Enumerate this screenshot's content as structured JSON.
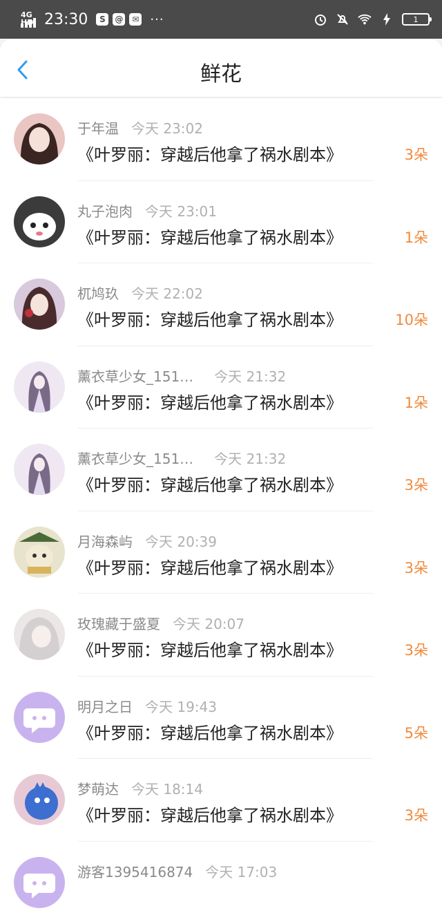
{
  "status_bar": {
    "network": "4G HD",
    "time": "23:30",
    "app_icons": [
      "S",
      "@",
      "✉"
    ],
    "more": "···",
    "battery": "1"
  },
  "header": {
    "title": "鲜花"
  },
  "rows": [
    {
      "name": "于年温",
      "time": "今天 23:02",
      "book": "《叶罗丽：穿越后他拿了祸水剧本》",
      "count": "3朵",
      "avatar_color": "#e9c6c2"
    },
    {
      "name": "丸子泡肉",
      "time": "今天 23:01",
      "book": "《叶罗丽：穿越后他拿了祸水剧本》",
      "count": "1朵",
      "avatar_color": "#3b3b3b"
    },
    {
      "name": "杌鸠玖",
      "time": "今天 22:02",
      "book": "《叶罗丽：穿越后他拿了祸水剧本》",
      "count": "10朵",
      "avatar_color": "#d8c9dc"
    },
    {
      "name": "薰衣草少女_151…",
      "time": "今天 21:32",
      "book": "《叶罗丽：穿越后他拿了祸水剧本》",
      "count": "1朵",
      "avatar_color": "#e8e0ef"
    },
    {
      "name": "薰衣草少女_151…",
      "time": "今天 21:32",
      "book": "《叶罗丽：穿越后他拿了祸水剧本》",
      "count": "3朵",
      "avatar_color": "#e8e0ef"
    },
    {
      "name": "月海森屿",
      "time": "今天 20:39",
      "book": "《叶罗丽：穿越后他拿了祸水剧本》",
      "count": "3朵",
      "avatar_color": "#d9d4b8"
    },
    {
      "name": "玫瑰藏于盛夏",
      "time": "今天 20:07",
      "book": "《叶罗丽：穿越后他拿了祸水剧本》",
      "count": "3朵",
      "avatar_color": "#e4e0de"
    },
    {
      "name": "明月之日",
      "time": "今天 19:43",
      "book": "《叶罗丽：穿越后他拿了祸水剧本》",
      "count": "5朵",
      "avatar_color": "#c9b3ee"
    },
    {
      "name": "梦萌达",
      "time": "今天 18:14",
      "book": "《叶罗丽：穿越后他拿了祸水剧本》",
      "count": "3朵",
      "avatar_color": "#5b86d6"
    },
    {
      "name": "游客1395416874",
      "time": "今天 17:03",
      "book": "",
      "count": "",
      "avatar_color": "#c9b3ee"
    }
  ],
  "colors": {
    "accent": "#2e9bf0",
    "count": "#f08a3c",
    "status_bar": "#4a4a4a"
  }
}
